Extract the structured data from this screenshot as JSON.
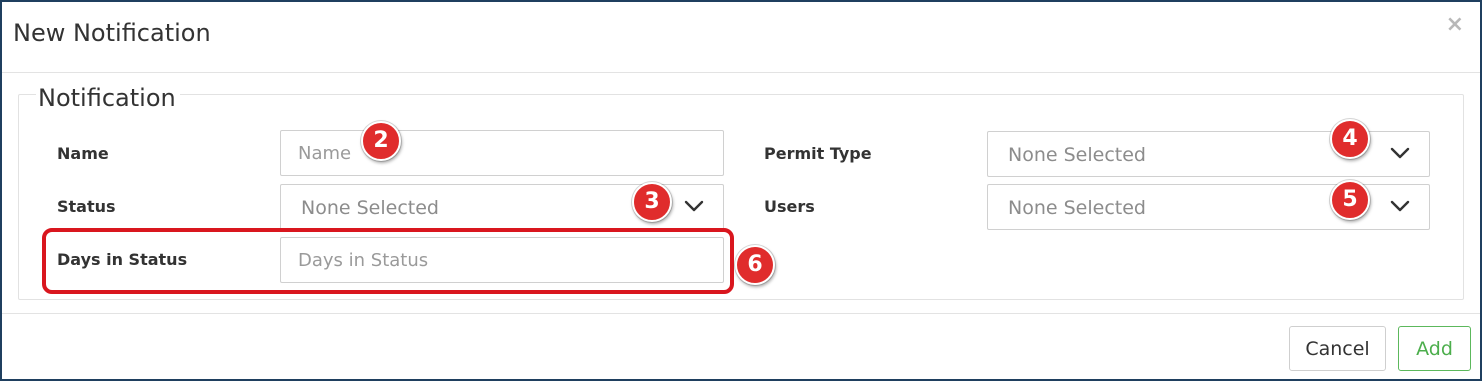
{
  "dialog": {
    "title": "New Notification",
    "close_glyph": "×"
  },
  "fieldset": {
    "legend": "Notification"
  },
  "fields": {
    "name": {
      "label": "Name",
      "placeholder": "Name",
      "value": ""
    },
    "status": {
      "label": "Status",
      "selected": "None Selected"
    },
    "days_in_status": {
      "label": "Days in Status",
      "placeholder": "Days in Status",
      "value": ""
    },
    "permit_type": {
      "label": "Permit Type",
      "selected": "None Selected"
    },
    "users": {
      "label": "Users",
      "selected": "None Selected"
    }
  },
  "callouts": {
    "name": "2",
    "status": "3",
    "permit_type": "4",
    "users": "5",
    "days_in_status": "6"
  },
  "footer": {
    "cancel_label": "Cancel",
    "add_label": "Add"
  },
  "colors": {
    "callout_red": "#e02c2c",
    "highlight_red": "#d9161e",
    "add_green": "#5cb85c",
    "dialog_border": "#1f3f5f"
  },
  "icons": {
    "close": "close-icon",
    "dropdown": "chevron-down-icon"
  }
}
